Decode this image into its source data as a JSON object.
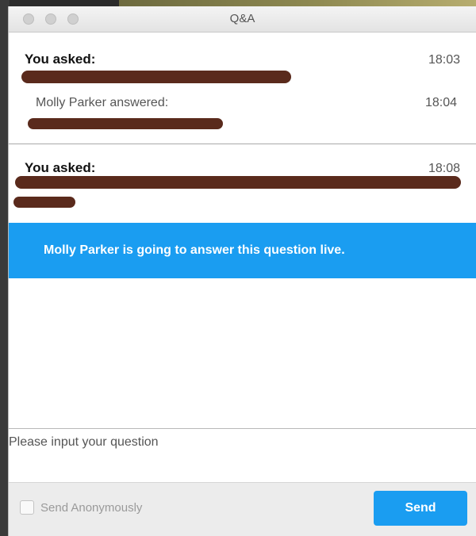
{
  "window": {
    "title": "Q&A"
  },
  "questions": [
    {
      "asked_label": "You asked:",
      "asked_time": "18:03",
      "answer": {
        "label": "Molly Parker answered:",
        "time": "18:04"
      }
    },
    {
      "asked_label": "You asked:",
      "asked_time": "18:08",
      "live_notice": "Molly Parker is going to answer this question live."
    }
  ],
  "input": {
    "placeholder": "Please input your question"
  },
  "footer": {
    "anonymous_label": "Send Anonymously",
    "send_label": "Send"
  },
  "colors": {
    "accent": "#1a9df1",
    "redaction": "#5a2a1c"
  }
}
